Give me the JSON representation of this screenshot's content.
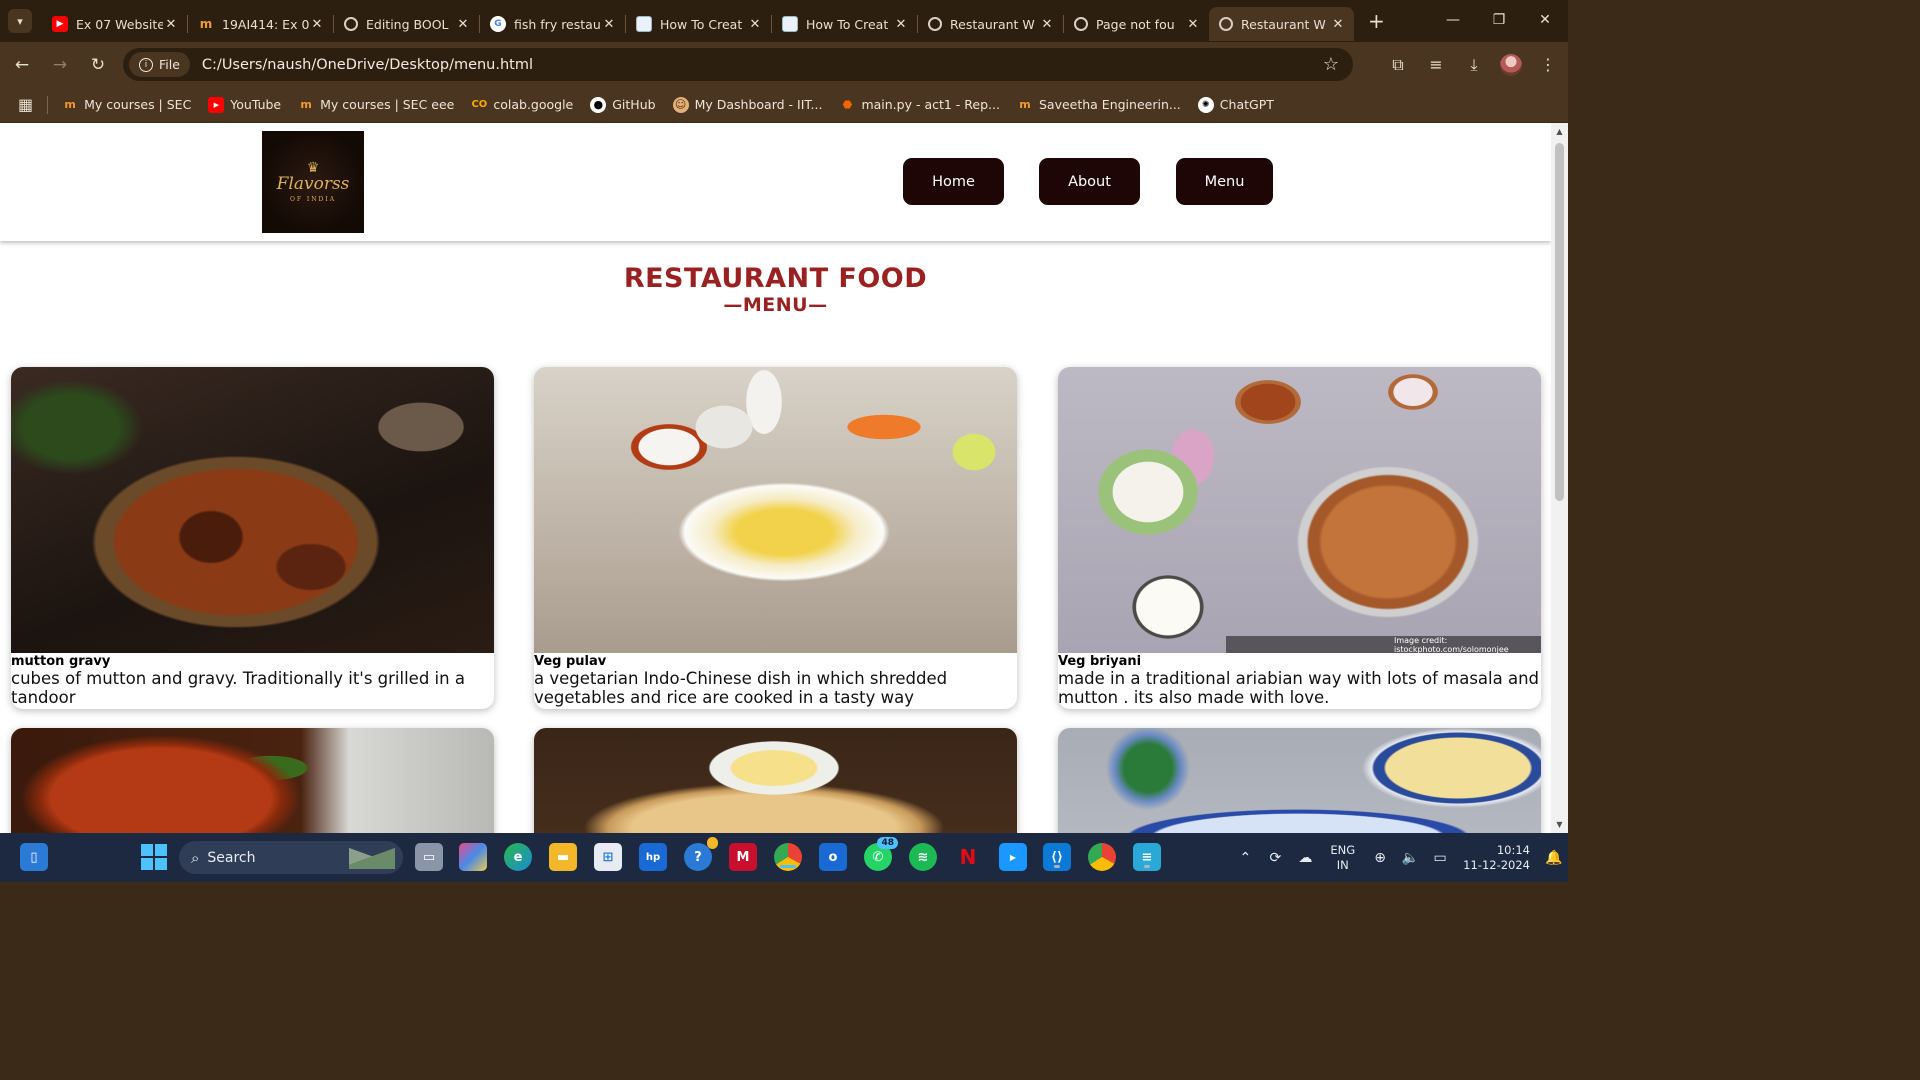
{
  "browser": {
    "tabs": [
      {
        "title": "Ex 07 Website",
        "icon": "youtube-icon",
        "active": false
      },
      {
        "title": "19AI414: Ex 0",
        "icon": "moodle-icon",
        "active": false
      },
      {
        "title": "Editing BOOL",
        "icon": "globe-icon",
        "active": false
      },
      {
        "title": "fish fry restau",
        "icon": "google-icon",
        "active": false
      },
      {
        "title": "How To Creat",
        "icon": "doc-icon",
        "active": false
      },
      {
        "title": "How To Creat",
        "icon": "doc-icon",
        "active": false
      },
      {
        "title": "Restaurant W",
        "icon": "globe-icon",
        "active": false
      },
      {
        "title": "Page not fou",
        "icon": "globe-icon",
        "active": false
      },
      {
        "title": "Restaurant W",
        "icon": "globe-icon",
        "active": true
      }
    ],
    "file_chip": "File",
    "url": "C:/Users/naush/OneDrive/Desktop/menu.html",
    "bookmarks": [
      {
        "label": "My courses | SEC",
        "icon": "moodle-icon"
      },
      {
        "label": "YouTube",
        "icon": "youtube-icon"
      },
      {
        "label": "My courses | SEC eee",
        "icon": "moodle-icon"
      },
      {
        "label": "colab.google",
        "icon": "colab-icon"
      },
      {
        "label": "GitHub",
        "icon": "github-icon"
      },
      {
        "label": "My Dashboard - IIT...",
        "icon": "dashboard-icon"
      },
      {
        "label": "main.py - act1 - Rep...",
        "icon": "replit-icon"
      },
      {
        "label": "Saveetha Engineerin...",
        "icon": "moodle-icon"
      },
      {
        "label": "ChatGPT",
        "icon": "chatgpt-icon"
      }
    ]
  },
  "site": {
    "logo": {
      "name": "Flavorss",
      "sub": "OF INDIA"
    },
    "nav": [
      "Home",
      "About",
      "Menu"
    ],
    "title": "RESTAURANT FOOD",
    "subtitle": "—MENU—",
    "items": [
      {
        "name": "mutton gravy",
        "desc": "cubes of mutton and gravy. Traditionally it's grilled in a tandoor"
      },
      {
        "name": "Veg pulav",
        "desc": "a vegetarian Indo-Chinese dish in which shredded vegetables and rice are cooked in a tasty way"
      },
      {
        "name": "Veg briyani",
        "desc": "made in a traditional ariabian way with lots of masala and mutton . its also made with love."
      }
    ],
    "image_credit": "Image credit: istockphoto.com/solomonjee",
    "colors": {
      "accent": "#9a2121",
      "nav_button": "#1e0606"
    }
  },
  "taskbar": {
    "search_placeholder": "Search",
    "whatsapp_badge": "48",
    "language": {
      "line1": "ENG",
      "line2": "IN"
    },
    "time": "10:14",
    "date": "11-12-2024"
  }
}
